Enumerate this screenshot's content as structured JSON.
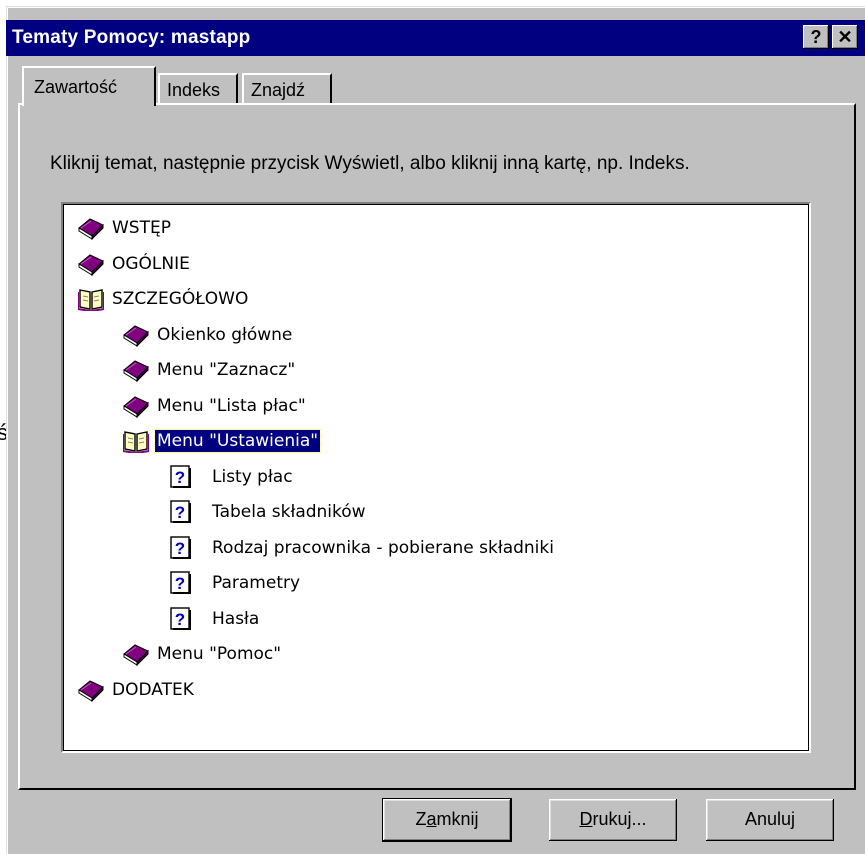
{
  "window": {
    "title": "Tematy Pomocy: mastapp",
    "help_button": "?",
    "close_button": "✕"
  },
  "tabs": [
    {
      "label": "Zawartość",
      "active": true
    },
    {
      "label": "Indeks",
      "active": false
    },
    {
      "label": "Znajdź",
      "active": false
    }
  ],
  "instruction": "Kliknij temat, następnie przycisk Wyświetl, albo kliknij inną kartę, np. Indeks.",
  "tree": {
    "items": [
      {
        "label": "WSTĘP",
        "icon": "closed-book-icon",
        "level": 0
      },
      {
        "label": "OGÓLNIE",
        "icon": "closed-book-icon",
        "level": 0
      },
      {
        "label": "SZCZEGÓŁOWO",
        "icon": "open-book-icon",
        "level": 0
      },
      {
        "label": "Okienko główne",
        "icon": "closed-book-icon",
        "level": 1
      },
      {
        "label": "Menu  \"Zaznacz\"",
        "icon": "closed-book-icon",
        "level": 1
      },
      {
        "label": "Menu  \"Lista płac\"",
        "icon": "closed-book-icon",
        "level": 1
      },
      {
        "label": "Menu  \"Ustawienia\"",
        "icon": "open-book-icon",
        "level": 1,
        "selected": true
      },
      {
        "label": "Listy płac",
        "icon": "help-topic-icon",
        "level": 2
      },
      {
        "label": "Tabela składników",
        "icon": "help-topic-icon",
        "level": 2
      },
      {
        "label": "Rodzaj pracownika - pobierane składniki",
        "icon": "help-topic-icon",
        "level": 2
      },
      {
        "label": "Parametry",
        "icon": "help-topic-icon",
        "level": 2
      },
      {
        "label": "Hasła",
        "icon": "help-topic-icon",
        "level": 2
      },
      {
        "label": "Menu  \"Pomoc\"",
        "icon": "closed-book-icon",
        "level": 1
      },
      {
        "label": "DODATEK",
        "icon": "closed-book-icon",
        "level": 0
      }
    ]
  },
  "buttons": {
    "close": {
      "label": "Zamknij",
      "mnemonic_index": 1
    },
    "print": {
      "label": "Drukuj...",
      "mnemonic_index": 0
    },
    "cancel": {
      "label": "Anuluj"
    }
  },
  "stray_glyph": "ś",
  "colors": {
    "titlebar": "#000080",
    "face": "#c0c0c0",
    "book": "#800080",
    "selection": "#000080"
  }
}
